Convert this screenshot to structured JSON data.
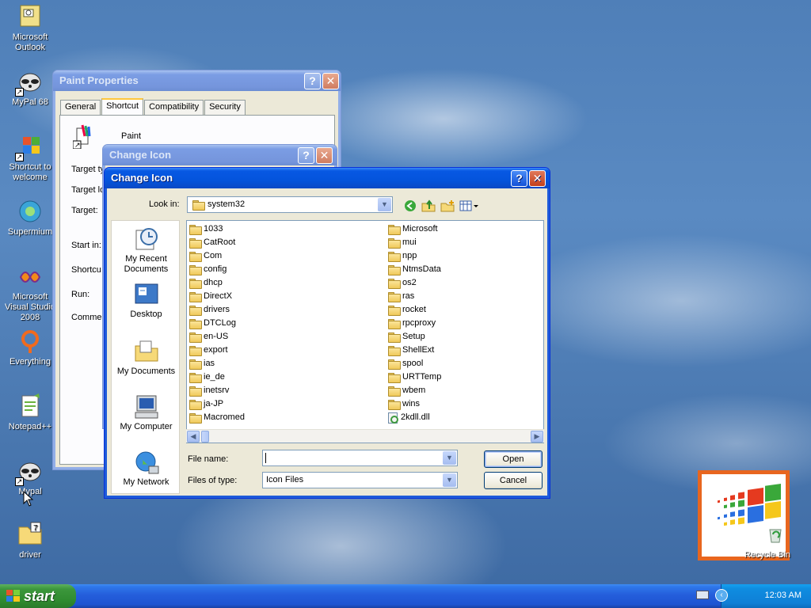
{
  "desktop": {
    "icons": [
      {
        "label": "Microsoft Outlook"
      },
      {
        "label": "MyPal 68"
      },
      {
        "label": "Shortcut to welcome"
      },
      {
        "label": "Supermium"
      },
      {
        "label": "Microsoft Visual Studio 2008"
      },
      {
        "label": "Everything"
      },
      {
        "label": "Notepad++"
      },
      {
        "label": "Mypal"
      },
      {
        "label": "driver"
      }
    ],
    "recycle_bin": "Recycle Bin"
  },
  "paint_properties": {
    "title": "Paint Properties",
    "tabs": [
      "General",
      "Shortcut",
      "Compatibility",
      "Security"
    ],
    "app_name": "Paint",
    "labels": [
      "Target ty",
      "Target lo",
      "Target:",
      "Start in:",
      "Shortcu",
      "Run:",
      "Commer"
    ]
  },
  "change_icon_back": {
    "title": "Change Icon"
  },
  "change_icon": {
    "title": "Change Icon",
    "look_in_label": "Look in:",
    "look_in_value": "system32",
    "places": [
      "My Recent Documents",
      "Desktop",
      "My Documents",
      "My Computer",
      "My Network"
    ],
    "files_col1": [
      "1033",
      "CatRoot",
      "Com",
      "config",
      "dhcp",
      "DirectX",
      "drivers",
      "DTCLog",
      "en-US",
      "export",
      "ias",
      "ie_de",
      "inetsrv",
      "ja-JP",
      "Macromed"
    ],
    "files_col2": [
      "Microsoft",
      "mui",
      "npp",
      "NtmsData",
      "os2",
      "ras",
      "rocket",
      "rpcproxy",
      "Setup",
      "ShellExt",
      "spool",
      "URTTemp",
      "wbem",
      "wins"
    ],
    "dll_file": "2kdll.dll",
    "file_name_label": "File name:",
    "file_name_value": "",
    "files_of_type_label": "Files of type:",
    "files_of_type_value": "Icon Files",
    "open_label": "Open",
    "cancel_label": "Cancel"
  },
  "taskbar": {
    "start_label": "start",
    "clock": "12:03 AM"
  },
  "colors": {
    "xp_blue_title": "#0758e3",
    "start_green": "#3c973c",
    "tray_blue": "#0f8ce0"
  }
}
